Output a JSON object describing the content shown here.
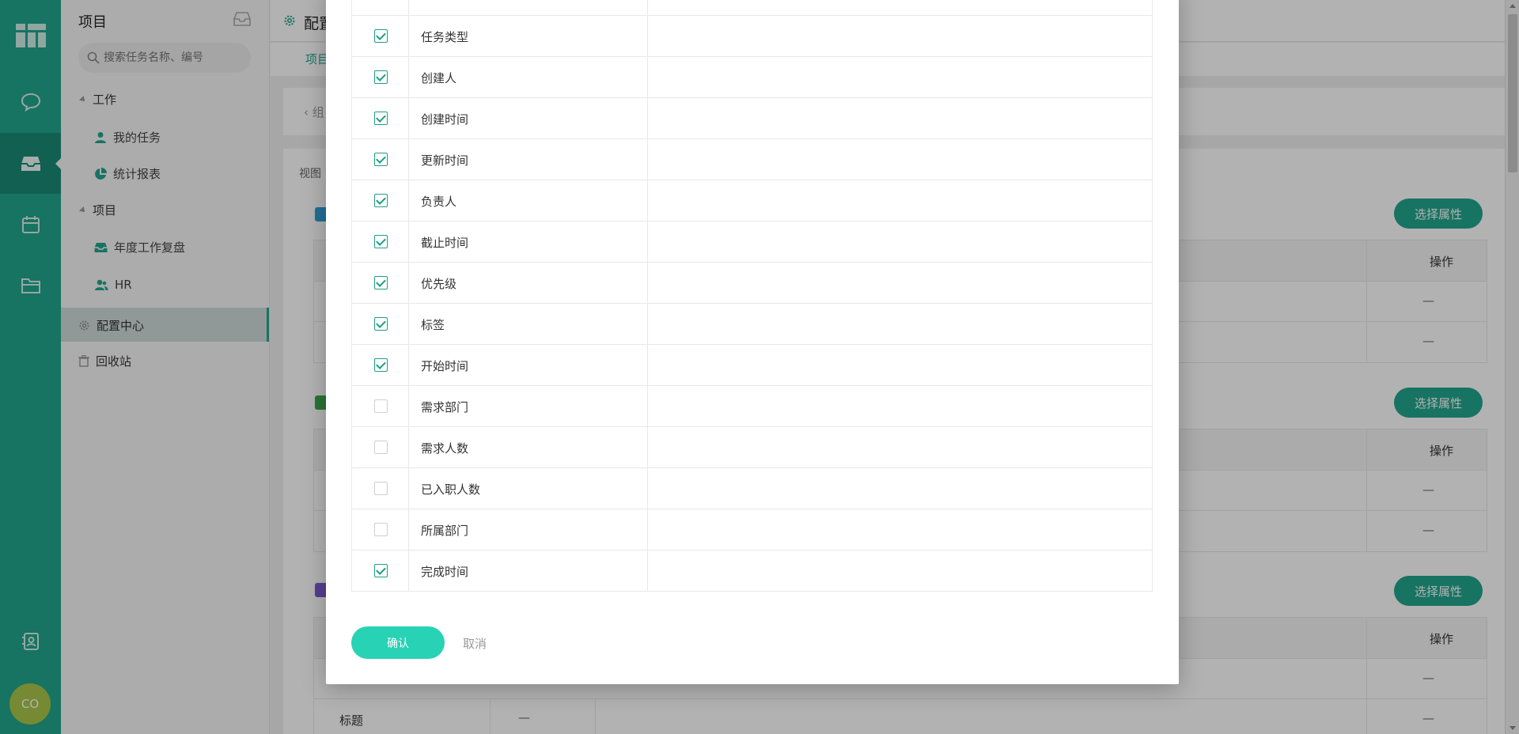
{
  "rail": {
    "icons": [
      "dashboard-icon",
      "chat-icon",
      "inbox-icon",
      "calendar-icon",
      "folder-icon",
      "contacts-icon"
    ],
    "avatar": "CO",
    "accent": "#22a58d"
  },
  "sidebar": {
    "title": "项目",
    "search_placeholder": "搜索任务名称、编号",
    "work_group": "工作",
    "my_tasks": "我的任务",
    "reports": "统计报表",
    "project_group": "项目",
    "project_annual": "年度工作复盘",
    "project_hr": "HR",
    "config_center": "配置中心",
    "recycle": "回收站"
  },
  "main": {
    "page_title": "配置",
    "sub_tab": "项目",
    "crumb": "组",
    "view_label": "视图",
    "select_attr_label": "选择属性",
    "op_header": "操作",
    "dash": "—",
    "title_cell": "标题"
  },
  "modal": {
    "rows": [
      {
        "label": "任务类型",
        "checked": true
      },
      {
        "label": "创建人",
        "checked": true
      },
      {
        "label": "创建时间",
        "checked": true
      },
      {
        "label": "更新时间",
        "checked": true
      },
      {
        "label": "负责人",
        "checked": true
      },
      {
        "label": "截止时间",
        "checked": true
      },
      {
        "label": "优先级",
        "checked": true
      },
      {
        "label": "标签",
        "checked": true
      },
      {
        "label": "开始时间",
        "checked": true
      },
      {
        "label": "需求部门",
        "checked": false
      },
      {
        "label": "需求人数",
        "checked": false
      },
      {
        "label": "已入职人数",
        "checked": false
      },
      {
        "label": "所属部门",
        "checked": false
      },
      {
        "label": "完成时间",
        "checked": true
      }
    ],
    "confirm": "确认",
    "cancel": "取消"
  }
}
